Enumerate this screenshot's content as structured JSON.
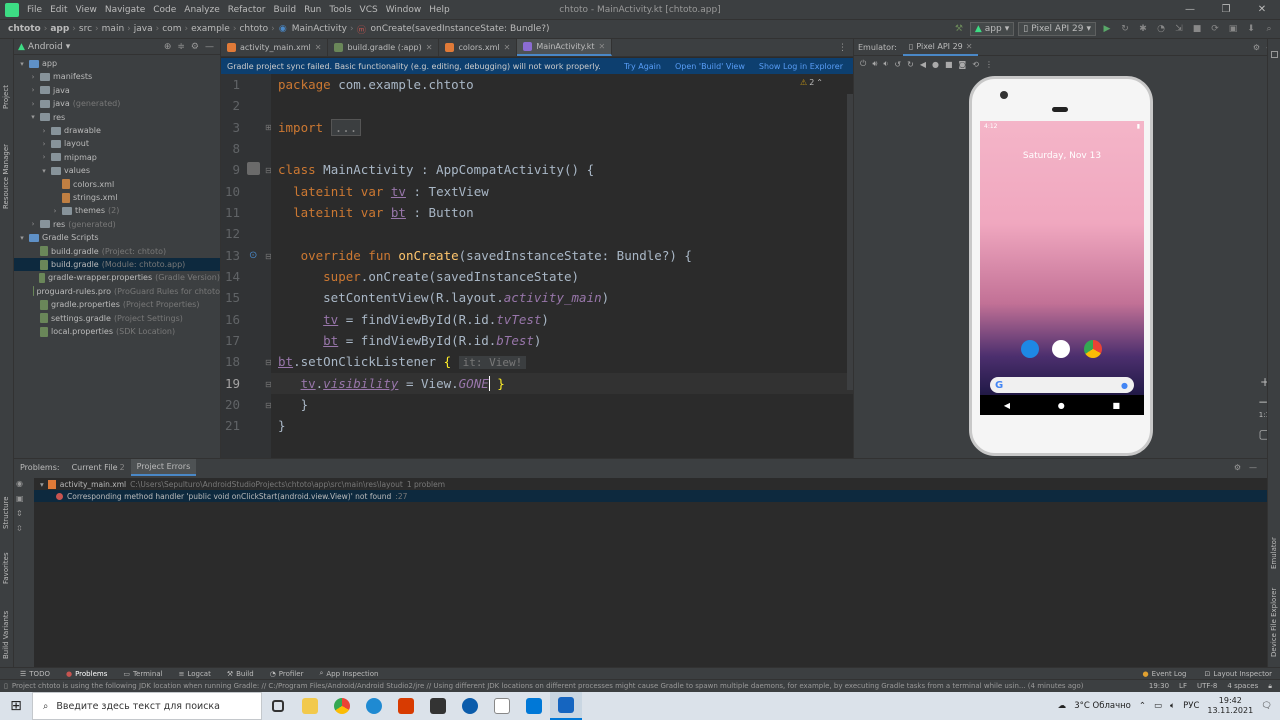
{
  "window": {
    "title": "chtoto - MainActivity.kt [chtoto.app]",
    "menu": [
      "File",
      "Edit",
      "View",
      "Navigate",
      "Code",
      "Analyze",
      "Refactor",
      "Build",
      "Run",
      "Tools",
      "VCS",
      "Window",
      "Help"
    ],
    "buttons": [
      "—",
      "❐",
      "✕"
    ]
  },
  "navbar": {
    "breadcrumbs": [
      "chtoto",
      "app",
      "src",
      "main",
      "java",
      "com",
      "example",
      "chtoto",
      "MainActivity",
      "onCreate(savedInstanceState: Bundle?)"
    ],
    "run_config": "app",
    "device": "Pixel API 29"
  },
  "project_panel": {
    "view_mode": "Android",
    "tree": [
      {
        "label": "app",
        "hint": "",
        "indent": 0,
        "type": "module",
        "expanded": true
      },
      {
        "label": "manifests",
        "hint": "",
        "indent": 1,
        "type": "folder"
      },
      {
        "label": "java",
        "hint": "",
        "indent": 1,
        "type": "folder"
      },
      {
        "label": "java",
        "hint": "(generated)",
        "indent": 1,
        "type": "folder"
      },
      {
        "label": "res",
        "hint": "",
        "indent": 1,
        "type": "folder",
        "expanded": true
      },
      {
        "label": "drawable",
        "hint": "",
        "indent": 2,
        "type": "folder"
      },
      {
        "label": "layout",
        "hint": "",
        "indent": 2,
        "type": "folder"
      },
      {
        "label": "mipmap",
        "hint": "",
        "indent": 2,
        "type": "folder"
      },
      {
        "label": "values",
        "hint": "",
        "indent": 2,
        "type": "folder",
        "expanded": true
      },
      {
        "label": "colors.xml",
        "hint": "",
        "indent": 3,
        "type": "file"
      },
      {
        "label": "strings.xml",
        "hint": "",
        "indent": 3,
        "type": "file"
      },
      {
        "label": "themes",
        "hint": "(2)",
        "indent": 3,
        "type": "folder"
      },
      {
        "label": "res",
        "hint": "(generated)",
        "indent": 1,
        "type": "folder"
      },
      {
        "label": "Gradle Scripts",
        "hint": "",
        "indent": 0,
        "type": "gradle-root",
        "expanded": true
      },
      {
        "label": "build.gradle",
        "hint": "(Project: chtoto)",
        "indent": 1,
        "type": "gradle"
      },
      {
        "label": "build.gradle",
        "hint": "(Module: chtoto.app)",
        "indent": 1,
        "type": "gradle",
        "selected": true
      },
      {
        "label": "gradle-wrapper.properties",
        "hint": "(Gradle Version)",
        "indent": 1,
        "type": "gradle"
      },
      {
        "label": "proguard-rules.pro",
        "hint": "(ProGuard Rules for chtoto",
        "indent": 1,
        "type": "gradle"
      },
      {
        "label": "gradle.properties",
        "hint": "(Project Properties)",
        "indent": 1,
        "type": "gradle"
      },
      {
        "label": "settings.gradle",
        "hint": "(Project Settings)",
        "indent": 1,
        "type": "gradle"
      },
      {
        "label": "local.properties",
        "hint": "(SDK Location)",
        "indent": 1,
        "type": "gradle"
      }
    ]
  },
  "editor": {
    "tabs": [
      {
        "label": "activity_main.xml",
        "icon": "xml",
        "active": false
      },
      {
        "label": "build.gradle (:app)",
        "icon": "gradle",
        "active": false
      },
      {
        "label": "colors.xml",
        "icon": "xml",
        "active": false
      },
      {
        "label": "MainActivity.kt",
        "icon": "kotlin",
        "active": true
      }
    ],
    "banner": {
      "message": "Gradle project sync failed. Basic functionality (e.g. editing, debugging) will not work properly.",
      "links": [
        "Try Again",
        "Open 'Build' View",
        "Show Log in Explorer"
      ]
    },
    "warnings_count": "2",
    "line_numbers": [
      "1",
      "2",
      "3",
      "8",
      "9",
      "10",
      "11",
      "12",
      "13",
      "14",
      "15",
      "16",
      "17",
      "18",
      "19",
      "20",
      "21"
    ],
    "code_lines": [
      "package com.example.chtoto",
      "",
      "import ...",
      "",
      "class MainActivity : AppCompatActivity() {",
      "    lateinit var tv : TextView",
      "    lateinit var bt : Button",
      "",
      "     override fun onCreate(savedInstanceState: Bundle?) {",
      "         super.onCreate(savedInstanceState)",
      "         setContentView(R.layout.activity_main)",
      "         tv = findViewById(R.id.tvTest)",
      "         bt = findViewById(R.id.bTest)",
      "bt.setOnClickListener {  it: View!",
      "     tv.visibility = View.GONE }",
      "     }",
      "}"
    ],
    "inlay_hint": "it: View!"
  },
  "emulator": {
    "panel_label": "Emulator:",
    "tab": "Pixel API 29",
    "phone": {
      "status_time": "4:12",
      "date_text": "Saturday, Nov 13",
      "search_logo": "G"
    },
    "zoom_label": "1:1"
  },
  "problems": {
    "tabs": [
      "Problems:",
      "Current File",
      "Project Errors"
    ],
    "current_file_count": "2",
    "file_row": {
      "file": "activity_main.xml",
      "path": "C:\\Users\\Sepulturo\\AndroidStudioProjects\\chtoto\\app\\src\\main\\res\\layout",
      "count": "1 problem"
    },
    "error_row": {
      "message": "Corresponding method handler 'public void onClickStart(android.view.View)' not found",
      "location": ":27"
    }
  },
  "tool_windows_bottom": [
    "TODO",
    "Problems",
    "Terminal",
    "Logcat",
    "Build",
    "Profiler",
    "App Inspection"
  ],
  "tool_windows_bottom_right": [
    "Event Log",
    "Layout Inspector"
  ],
  "left_stripe": [
    "Project",
    "Resource Manager",
    "Structure",
    "Favorites",
    "Build Variants"
  ],
  "right_stripe": [
    "Emulator",
    "Device File Explorer"
  ],
  "statusbar": {
    "message": "Project chtoto is using the following JDK location when running Gradle: // C:/Program Files/Android/Android Studio2/jre // Using different JDK locations on different processes might cause Gradle to spawn multiple daemons, for example, by executing Gradle tasks from a terminal while usin... (4 minutes ago)",
    "caret": "19:30",
    "line_sep": "LF",
    "encoding": "UTF-8",
    "indent": "4 spaces"
  },
  "taskbar": {
    "search_placeholder": "Введите здесь текст для поиска",
    "weather": "3°C  Облачно",
    "lang": "РУС",
    "time": "19:42",
    "date": "13.11.2021"
  }
}
